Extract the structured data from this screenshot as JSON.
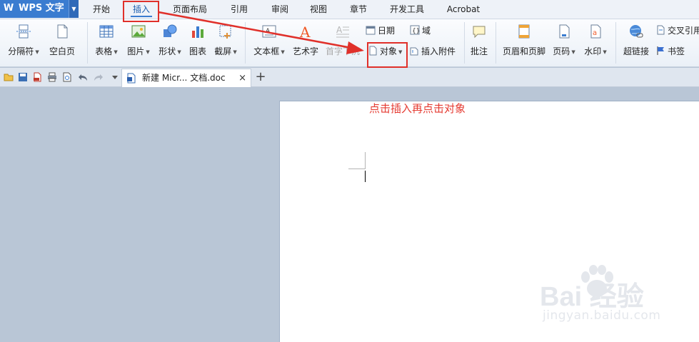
{
  "app": {
    "logo": "W",
    "name": "WPS 文字",
    "accent": "#3a7cd0"
  },
  "menu": {
    "tabs": [
      "开始",
      "插入",
      "页面布局",
      "引用",
      "审阅",
      "视图",
      "章节",
      "开发工具",
      "Acrobat"
    ],
    "active": "插入"
  },
  "ribbon": {
    "page_break": "分隔符",
    "blank_page": "空白页",
    "table": "表格",
    "picture": "图片",
    "shape": "形状",
    "chart": "图表",
    "screenshot": "截屏",
    "textbox": "文本框",
    "wordart": "艺术字",
    "dropcap": "首字下沉",
    "date": "日期",
    "field": "域",
    "object": "对象",
    "attachment": "插入附件",
    "comment": "批注",
    "header_footer": "页眉和页脚",
    "page_number": "页码",
    "watermark": "水印",
    "hyperlink": "超链接",
    "cross_ref": "交叉引用",
    "bookmark": "书签"
  },
  "document": {
    "tab_name": "新建 Micr... 文档.doc",
    "close": "×",
    "new_tab": "+"
  },
  "annotation": {
    "text": "点击插入再点击对象",
    "color": "#e53a31"
  },
  "watermark": {
    "brand": "Bai 经验",
    "url": "jingyan.baidu.com"
  }
}
